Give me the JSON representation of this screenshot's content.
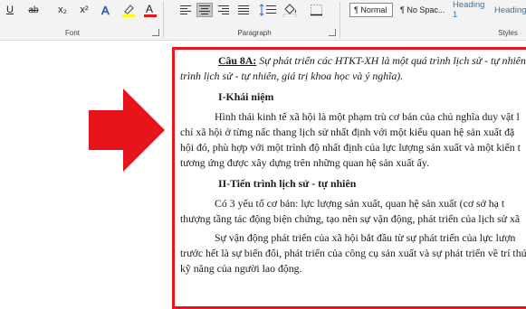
{
  "ribbon": {
    "font_group": {
      "label": "Font",
      "buttons": [
        "U",
        "ab",
        "x₂",
        "x²",
        "A",
        "A"
      ],
      "accent_colors": {
        "highlight": "#ffff00",
        "font_color": "#e8141c"
      }
    },
    "paragraph_group": {
      "label": "Paragraph",
      "align_buttons": [
        "align-left",
        "align-center",
        "align-right",
        "justify"
      ],
      "extra": [
        "line-spacing",
        "shading",
        "borders"
      ]
    },
    "styles_group": {
      "label": "Styles",
      "items": [
        "¶ Normal",
        "¶ No Spac...",
        "Heading 1",
        "Heading"
      ]
    }
  },
  "document": {
    "question_label": "Câu 8A:",
    "question_text": " Sự phát triển các HTKT-XH là một quá trình lịch sử - tự nhiên (",
    "question_text_2": "trình lịch sử - tự nhiên, giá trị khoa học và ý nghĩa).",
    "heading_1": "I-Khái niệm",
    "para_1_lines": [
      "Hình thái kinh tế xã hội là một phạm trù cơ bản của chủ nghĩa duy vật l",
      "chỉ xã hội ở từng nấc thang lịch sử nhất định với một kiểu quan hệ sản xuất đặ",
      "hội đó, phù hợp với một trình độ nhất định của lực lượng sản xuất và một kiến t",
      "tương ứng được xây dựng trên những quan hệ sản xuất ấy."
    ],
    "heading_2": "II-Tiến trình lịch sử - tự nhiên",
    "para_2_lines": [
      "Có 3 yếu tố cơ bản: lực lượng sản xuất, quan hệ sản xuất (cơ sở hạ t",
      "thượng tầng tác động biện chứng, tạo nên sự vận động, phát triển của lịch sử xã"
    ],
    "para_3_lines": [
      "Sự vận động phát triển của xã hội bắt đầu từ sự phát triển của lực lượn",
      "trước hết là sự biến đổi, phát triển của công cụ sản xuất và sự phát triển về trí thứ",
      "kỹ năng của người lao động."
    ]
  },
  "colors": {
    "arrow": "#e8141c",
    "frame": "#e8141c",
    "heading_style": "#2e74b5"
  }
}
